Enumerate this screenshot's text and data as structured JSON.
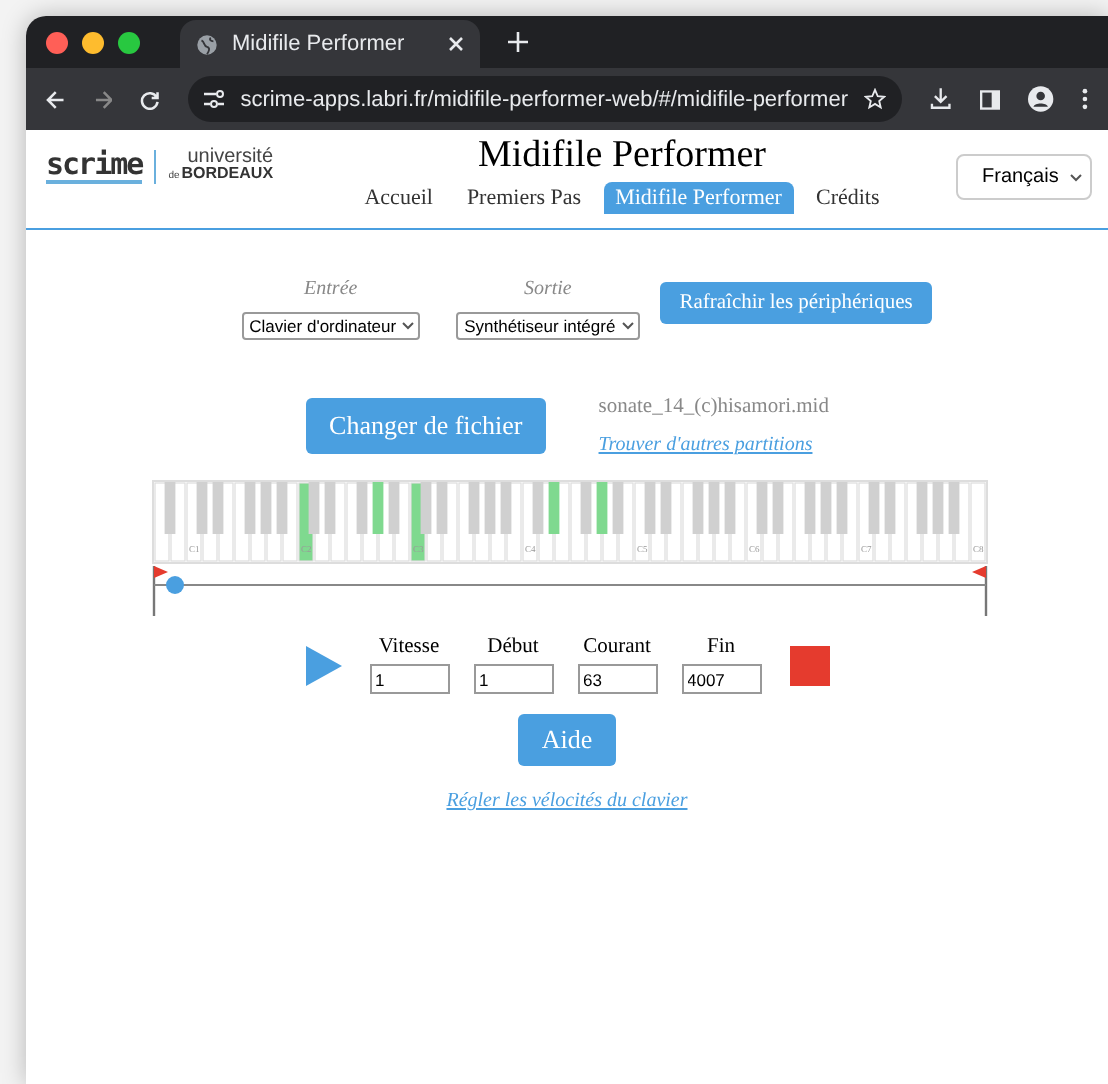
{
  "browser": {
    "tab_title": "Midifile Performer",
    "url": "scrime-apps.labri.fr/midifile-performer-web/#/midifile-performer"
  },
  "header": {
    "logo_scrime": "scrime",
    "logo_university": [
      "université",
      "de",
      "BORDEAUX"
    ],
    "title": "Midifile Performer",
    "language": "Français",
    "nav": [
      {
        "label": "Accueil",
        "selected": false
      },
      {
        "label": "Premiers Pas",
        "selected": false
      },
      {
        "label": "Midifile Performer",
        "selected": true
      },
      {
        "label": "Crédits",
        "selected": false
      }
    ]
  },
  "devices": {
    "input_label": "Entrée",
    "input_value": "Clavier d'ordinateur",
    "output_label": "Sortie",
    "output_value": "Synthétiseur intégré",
    "refresh_button": "Rafraîchir les périphériques"
  },
  "file": {
    "button": "Changer de fichier",
    "name": "sonate_14_(c)hisamori.mid",
    "link": "Trouver d'autres partitions"
  },
  "keyboard": {
    "octave_labels": [
      "C1",
      "C2",
      "C3",
      "C4",
      "C5",
      "C6",
      "C7",
      "C8"
    ],
    "keys": [
      {
        "pressed": false
      },
      {
        "pressed": false
      },
      {
        "pressed": false
      },
      {
        "pressed": false
      },
      {
        "pressed": false
      },
      {
        "pressed": false
      },
      {
        "pressed": false
      },
      {
        "pressed": false
      },
      {
        "pressed": false
      },
      {
        "pressed": false
      },
      {
        "pressed": false
      },
      {
        "pressed": false
      },
      {
        "pressed": false
      },
      {
        "pressed": false
      },
      {
        "pressed": false
      },
      {
        "pressed": true
      },
      {
        "pressed": false
      },
      {
        "pressed": false
      },
      {
        "pressed": false
      },
      {
        "pressed": false
      },
      {
        "pressed": false
      },
      {
        "pressed": false
      },
      {
        "pressed": false
      },
      {
        "pressed": true
      },
      {
        "pressed": false
      },
      {
        "pressed": false
      },
      {
        "pressed": false
      },
      {
        "pressed": true
      },
      {
        "pressed": false
      },
      {
        "pressed": false
      },
      {
        "pressed": false
      },
      {
        "pressed": false
      },
      {
        "pressed": false
      },
      {
        "pressed": false
      },
      {
        "pressed": false
      },
      {
        "pressed": false
      },
      {
        "pressed": false
      },
      {
        "pressed": false
      },
      {
        "pressed": false
      },
      {
        "pressed": false
      },
      {
        "pressed": false
      },
      {
        "pressed": false
      },
      {
        "pressed": true
      },
      {
        "pressed": false
      },
      {
        "pressed": false
      },
      {
        "pressed": false
      },
      {
        "pressed": false
      },
      {
        "pressed": true
      },
      {
        "pressed": false
      },
      {
        "pressed": false
      },
      {
        "pressed": false
      },
      {
        "pressed": false
      },
      {
        "pressed": false
      },
      {
        "pressed": false
      },
      {
        "pressed": false
      },
      {
        "pressed": false
      },
      {
        "pressed": false
      },
      {
        "pressed": false
      },
      {
        "pressed": false
      },
      {
        "pressed": false
      },
      {
        "pressed": false
      },
      {
        "pressed": false
      },
      {
        "pressed": false
      },
      {
        "pressed": false
      },
      {
        "pressed": false
      },
      {
        "pressed": false
      },
      {
        "pressed": false
      },
      {
        "pressed": false
      },
      {
        "pressed": false
      },
      {
        "pressed": false
      },
      {
        "pressed": false
      },
      {
        "pressed": false
      },
      {
        "pressed": false
      },
      {
        "pressed": false
      },
      {
        "pressed": false
      },
      {
        "pressed": false
      },
      {
        "pressed": false
      },
      {
        "pressed": false
      },
      {
        "pressed": false
      },
      {
        "pressed": false
      },
      {
        "pressed": false
      },
      {
        "pressed": false
      },
      {
        "pressed": false
      },
      {
        "pressed": false
      },
      {
        "pressed": false
      },
      {
        "pressed": false
      },
      {
        "pressed": false
      },
      {
        "pressed": false
      }
    ]
  },
  "position": {
    "level": 0.016
  },
  "transport": {
    "playing": false,
    "fields": [
      {
        "label": "Vitesse",
        "value": "1"
      },
      {
        "label": "Début",
        "value": "1"
      },
      {
        "label": "Courant",
        "value": "63"
      },
      {
        "label": "Fin",
        "value": "4007"
      }
    ]
  },
  "help_button": "Aide",
  "velocity_link": "Régler les vélocités du clavier"
}
